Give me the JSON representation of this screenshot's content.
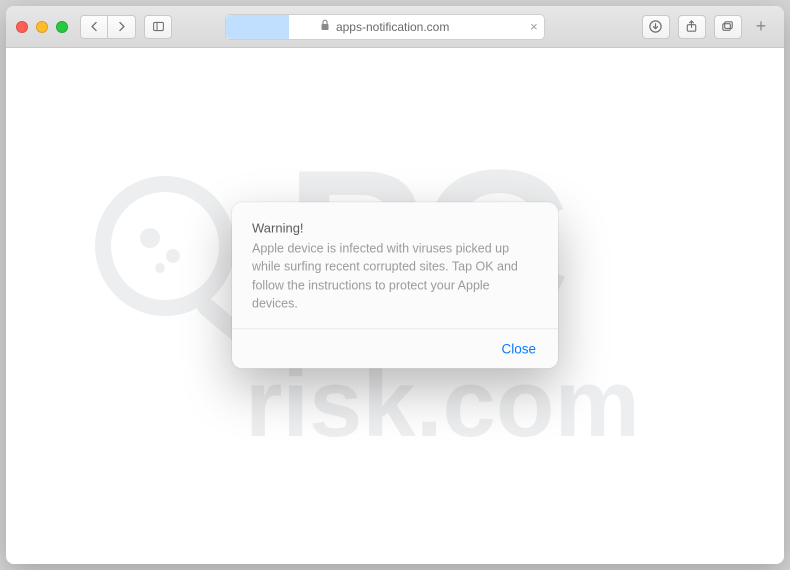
{
  "toolbar": {
    "traffic": {
      "close": "close",
      "minimize": "minimize",
      "zoom": "zoom"
    },
    "back": "Back",
    "forward": "Forward",
    "sidebar": "Sidebar",
    "address": {
      "lock": "lock",
      "url": "apps-notification.com",
      "clear": "×"
    },
    "downloads": "Downloads",
    "share": "Share",
    "tabs": "Show tabs",
    "newtab": "+"
  },
  "watermark": {
    "text_primary": "PC",
    "text_secondary": "risk.com"
  },
  "modal": {
    "title": "Warning!",
    "body": "Apple device is infected with viruses picked up while surfing recent corrupted sites. Tap OK and follow the instructions to protect your Apple devices.",
    "close_label": "Close"
  }
}
